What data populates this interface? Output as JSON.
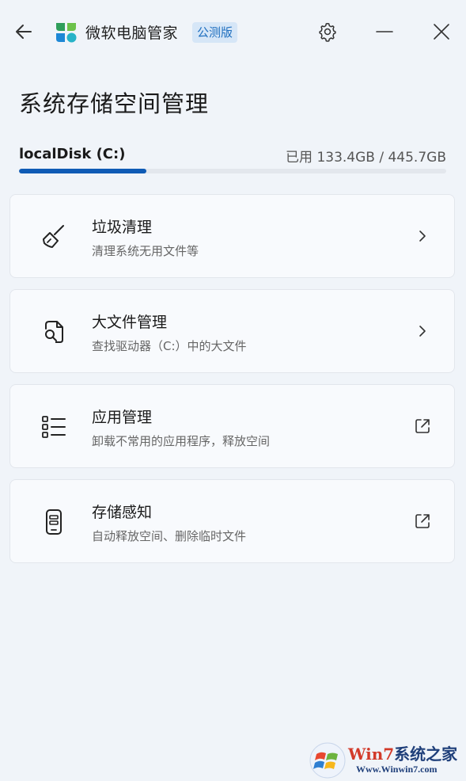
{
  "titlebar": {
    "app_name": "微软电脑管家",
    "badge": "公测版"
  },
  "page": {
    "title": "系统存储空间管理"
  },
  "disk": {
    "name": "localDisk (C:)",
    "usage_text": "已用 133.4GB / 445.7GB",
    "used_fraction": 0.299
  },
  "cards": [
    {
      "title": "垃圾清理",
      "desc": "清理系统无用文件等",
      "icon": "broom-icon",
      "trail": "chevron-right-icon"
    },
    {
      "title": "大文件管理",
      "desc": "查找驱动器（C:）中的大文件",
      "icon": "file-search-icon",
      "trail": "chevron-right-icon"
    },
    {
      "title": "应用管理",
      "desc": "卸载不常用的应用程序，释放空间",
      "icon": "list-icon",
      "trail": "external-link-icon"
    },
    {
      "title": "存储感知",
      "desc": "自动释放空间、删除临时文件",
      "icon": "phone-storage-icon",
      "trail": "external-link-icon"
    }
  ],
  "watermark": {
    "title_prefix": "Win7",
    "title_suffix": "系统之家",
    "url": "Www.Winwin7.com"
  },
  "colors": {
    "accent": "#0f5bb5",
    "background": "#f0f4f9",
    "card": "#f8fafd"
  }
}
